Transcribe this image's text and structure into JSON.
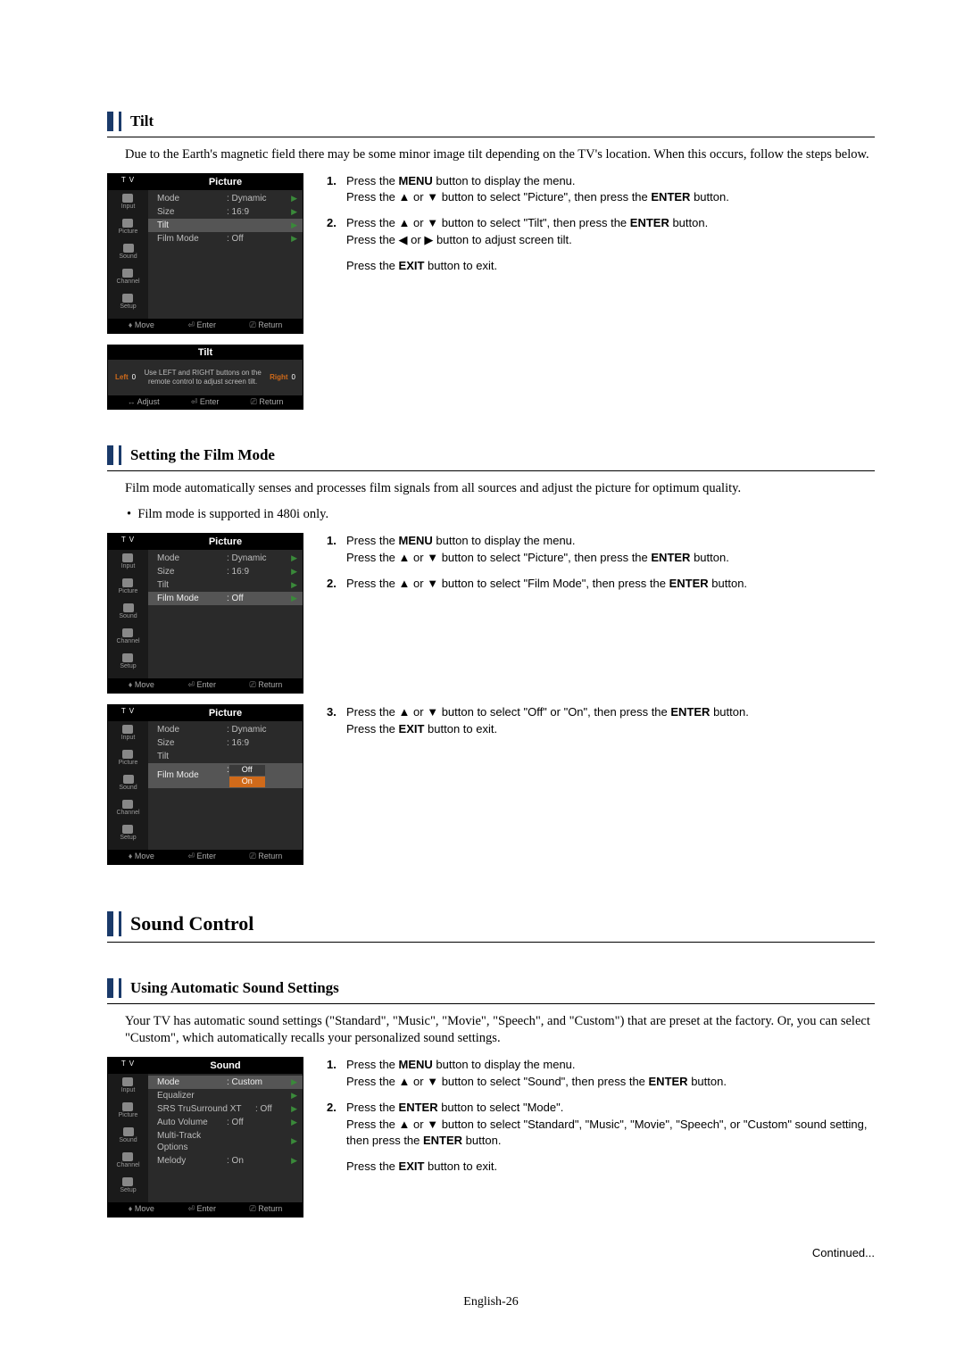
{
  "symbols": {
    "up": "▲",
    "down": "▼",
    "left": "◀",
    "right": "▶",
    "mv": "♦",
    "adj": "↔",
    "ent": "⏎",
    "ret": "⎚"
  },
  "tilt": {
    "heading": "Tilt",
    "intro": "Due to the Earth's magnetic field there may be some minor image tilt depending on the TV's location. When this occurs, follow the steps below.",
    "steps": {
      "s1a": "Press the ",
      "s1b": "MENU",
      "s1c": " button to display the menu.",
      "s1d": "Press the ",
      "s1e": " or ",
      "s1f": " button to select \"Picture\", then press the ",
      "s1g": "ENTER",
      "s1h": " button.",
      "s2a": "Press the ",
      "s2b": " or ",
      "s2c": " button to select \"Tilt\", then press the ",
      "s2d": "ENTER",
      "s2e": " button.",
      "s2f": "Press the ",
      "s2g": " or ",
      "s2h": " button to adjust screen tilt.",
      "exitA": "Press the ",
      "exitB": "EXIT",
      "exitC": " button to exit."
    },
    "osd": {
      "tv": "T V",
      "title": "Picture",
      "side": [
        "Input",
        "Picture",
        "Sound",
        "Channel",
        "Setup"
      ],
      "rows": [
        {
          "label": "Mode",
          "val": ": Dynamic",
          "chev": true
        },
        {
          "label": "Size",
          "val": ": 16:9",
          "chev": true
        },
        {
          "label": "Tilt",
          "val": "",
          "chev": true,
          "hl": true
        },
        {
          "label": "Film Mode",
          "val": ": Off",
          "chev": true
        }
      ],
      "bot": {
        "mv": "Move",
        "ent": "Enter",
        "ret": "Return"
      }
    },
    "tiltOsd": {
      "title": "Tilt",
      "left": "Left",
      "leftNum": "0",
      "msg": "Use LEFT and RIGHT buttons on the remote control to adjust screen tilt.",
      "right": "Right",
      "rightNum": "0",
      "bot": {
        "adj": "Adjust",
        "ent": "Enter",
        "ret": "Return"
      }
    }
  },
  "film": {
    "heading": "Setting the Film Mode",
    "intro": "Film mode automatically senses and processes film signals from all sources and adjust the picture for optimum quality.",
    "bullet": "Film mode is supported in 480i only.",
    "steps": {
      "s1a": "Press the ",
      "s1b": "MENU",
      "s1c": " button to display the menu.",
      "s1d": "Press the ",
      "s1e": " or ",
      "s1f": " button to select \"Picture\", then press the ",
      "s1g": "ENTER",
      "s1h": " button.",
      "s2a": "Press the ",
      "s2b": " or ",
      "s2c": " button to select \"Film Mode\", then press the ",
      "s2d": "ENTER",
      "s2e": " button.",
      "s3a": "Press the ",
      "s3b": " or ",
      "s3c": " button to select \"Off\" or \"On\", then press the ",
      "s3d": "ENTER",
      "s3e": " button.",
      "exitA": "Press the ",
      "exitB": "EXIT",
      "exitC": " button to exit."
    },
    "osd1": {
      "tv": "T V",
      "title": "Picture",
      "side": [
        "Input",
        "Picture",
        "Sound",
        "Channel",
        "Setup"
      ],
      "rows": [
        {
          "label": "Mode",
          "val": ": Dynamic",
          "chev": true
        },
        {
          "label": "Size",
          "val": ": 16:9",
          "chev": true
        },
        {
          "label": "Tilt",
          "val": "",
          "chev": true
        },
        {
          "label": "Film Mode",
          "val": ": Off",
          "chev": true,
          "hl": true
        }
      ],
      "bot": {
        "mv": "Move",
        "ent": "Enter",
        "ret": "Return"
      }
    },
    "osd2": {
      "tv": "T V",
      "title": "Picture",
      "side": [
        "Input",
        "Picture",
        "Sound",
        "Channel",
        "Setup"
      ],
      "rows": [
        {
          "label": "Mode",
          "val": ": Dynamic",
          "chev": false
        },
        {
          "label": "Size",
          "val": ": 16:9",
          "chev": false
        },
        {
          "label": "Tilt",
          "val": "",
          "chev": false
        },
        {
          "label": "Film Mode",
          "val": ":",
          "chev": false,
          "hl": true,
          "popup": [
            "Off",
            "On"
          ],
          "popupSel": 1
        }
      ],
      "bot": {
        "mv": "Move",
        "ent": "Enter",
        "ret": "Return"
      }
    }
  },
  "soundHeading": "Sound Control",
  "autoSound": {
    "heading": "Using Automatic Sound Settings",
    "intro": "Your TV has automatic sound settings (\"Standard\", \"Music\", \"Movie\", \"Speech\", and \"Custom\") that are preset at the factory. Or, you can select \"Custom\", which automatically recalls your personalized sound settings.",
    "steps": {
      "s1a": "Press the ",
      "s1b": "MENU",
      "s1c": " button to display the menu.",
      "s1d": "Press the ",
      "s1e": " or ",
      "s1f": " button to select \"Sound\", then press the ",
      "s1g": "ENTER",
      "s1h": " button.",
      "s2a": "Press the ",
      "s2b": "ENTER",
      "s2c": " button to select \"Mode\".",
      "s2d": "Press the ",
      "s2e": " or ",
      "s2f": " button to select \"Standard\", \"Music\", \"Movie\", \"Speech\", or \"Custom\" sound setting, then press the ",
      "s2g": "ENTER",
      "s2h": " button.",
      "exitA": "Press the ",
      "exitB": "EXIT",
      "exitC": " button to exit."
    },
    "osd": {
      "tv": "T V",
      "title": "Sound",
      "side": [
        "Input",
        "Picture",
        "Sound",
        "Channel",
        "Setup"
      ],
      "rows": [
        {
          "label": "Mode",
          "val": ": Custom",
          "chev": true,
          "hl": true
        },
        {
          "label": "Equalizer",
          "val": "",
          "chev": true
        },
        {
          "label": "SRS TruSurround XT",
          "val": ": Off",
          "chev": true,
          "wide": true
        },
        {
          "label": "Auto Volume",
          "val": ": Off",
          "chev": true
        },
        {
          "label": "Multi-Track Options",
          "val": "",
          "chev": true
        },
        {
          "label": "Melody",
          "val": ": On",
          "chev": true
        }
      ],
      "bot": {
        "mv": "Move",
        "ent": "Enter",
        "ret": "Return"
      }
    }
  },
  "continued": "Continued...",
  "footer": "English-26"
}
